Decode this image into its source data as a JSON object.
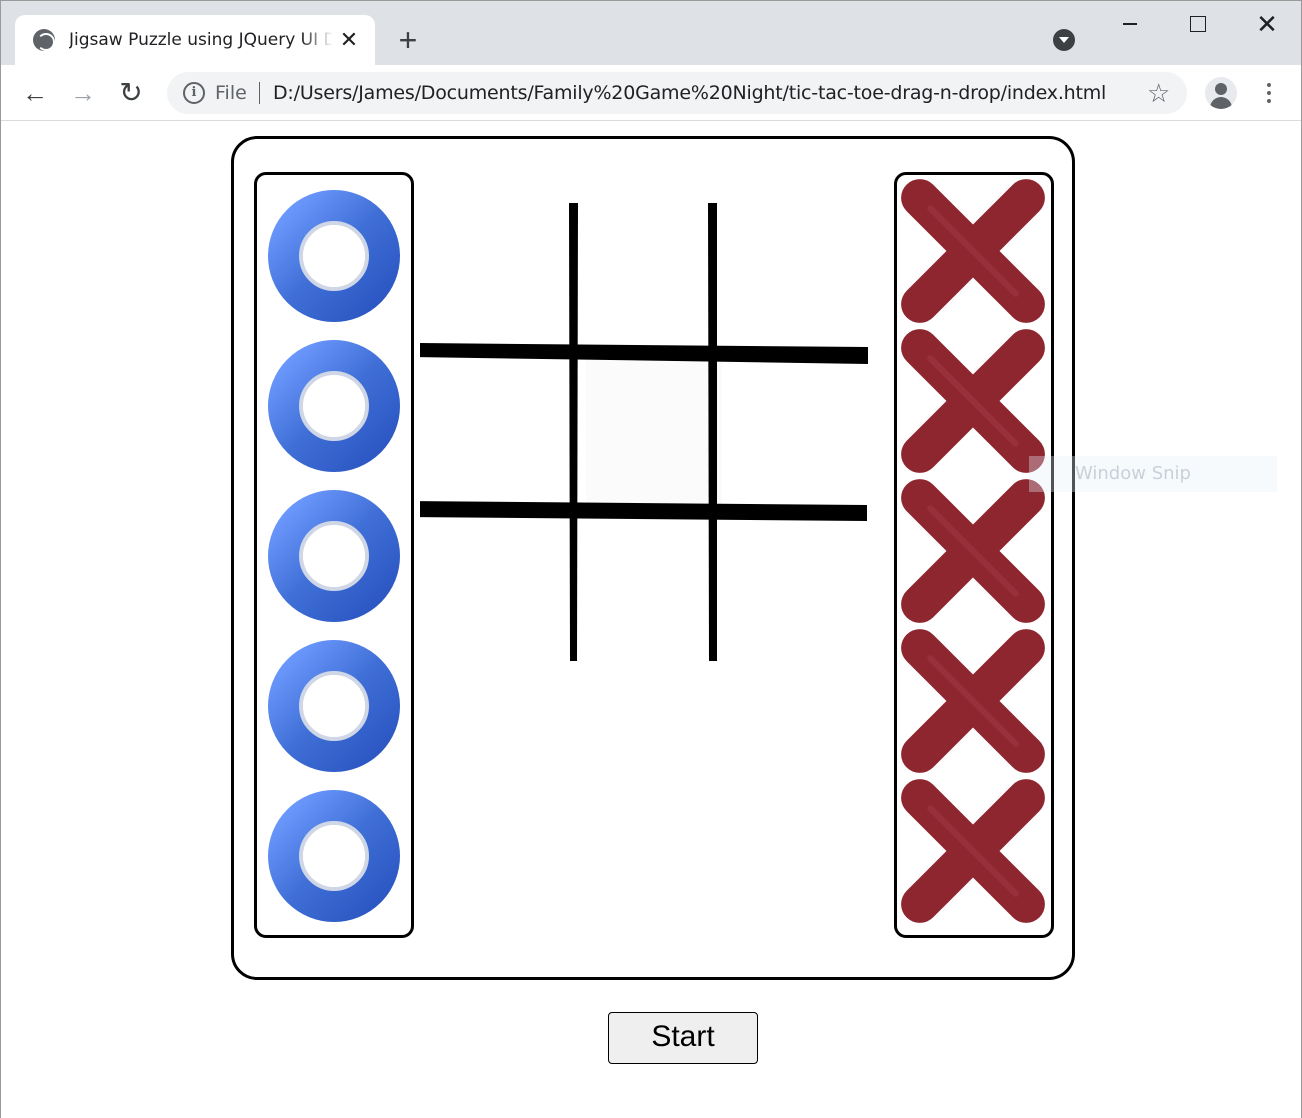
{
  "browser": {
    "tab_title": "Jigsaw Puzzle using JQuery UI Drag and Drop",
    "tab_close_glyph": "✕",
    "new_tab_glyph": "+",
    "omnibox": {
      "scheme_label": "File",
      "url": "D:/Users/James/Documents/Family%20Game%20Night/tic-tac-toe-drag-n-drop/index.html"
    },
    "icons": {
      "back": "←",
      "forward": "→",
      "reload": "↻",
      "info": "i",
      "star": "☆",
      "close": "✕"
    }
  },
  "game": {
    "o_pieces": [
      {
        "id": "o-1",
        "icon": "o-ring-icon"
      },
      {
        "id": "o-2",
        "icon": "o-ring-icon"
      },
      {
        "id": "o-3",
        "icon": "o-ring-icon"
      },
      {
        "id": "o-4",
        "icon": "o-ring-icon"
      },
      {
        "id": "o-5",
        "icon": "o-ring-icon"
      }
    ],
    "x_pieces": [
      {
        "id": "x-1",
        "icon": "x-cross-icon"
      },
      {
        "id": "x-2",
        "icon": "x-cross-icon"
      },
      {
        "id": "x-3",
        "icon": "x-cross-icon"
      },
      {
        "id": "x-4",
        "icon": "x-cross-icon"
      },
      {
        "id": "x-5",
        "icon": "x-cross-icon"
      }
    ],
    "start_label": "Start",
    "colors": {
      "o_piece": "#3f6fd6",
      "x_piece": "#8e2630",
      "board_lines": "#000000"
    }
  },
  "overlay": {
    "snip_label": "Window Snip"
  }
}
